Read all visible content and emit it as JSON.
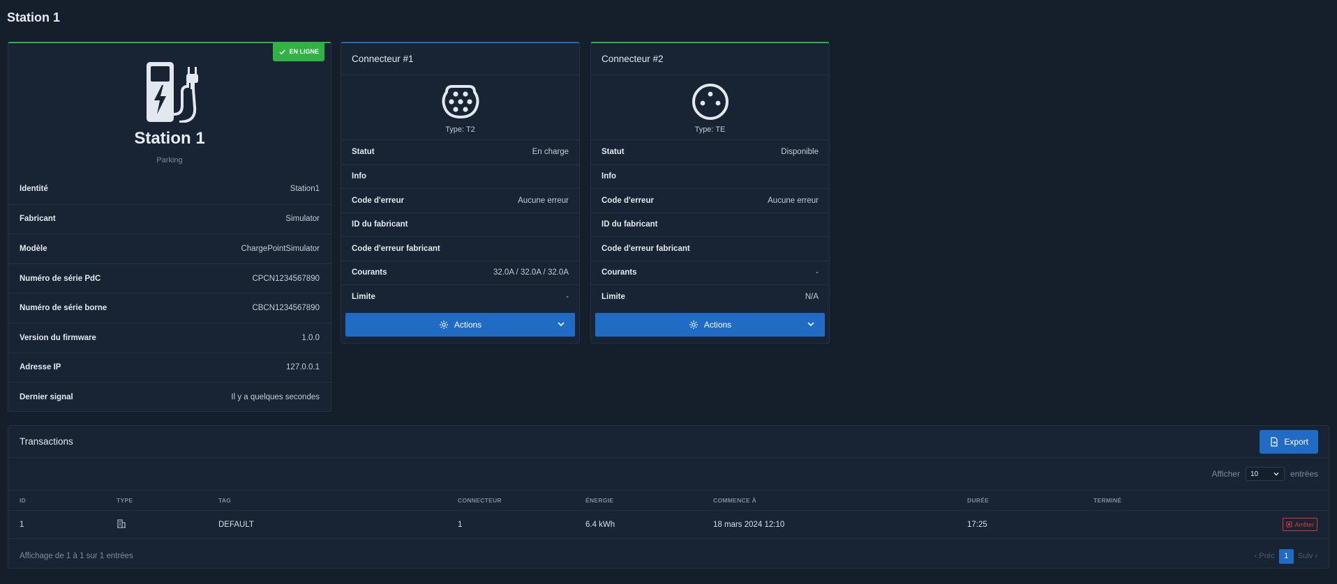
{
  "page": {
    "title": "Station 1"
  },
  "station": {
    "status_badge": "EN LIGNE",
    "name": "Station 1",
    "location": "Parking",
    "details": [
      {
        "key": "Identité",
        "value": "Station1"
      },
      {
        "key": "Fabricant",
        "value": "Simulator"
      },
      {
        "key": "Modèle",
        "value": "ChargePointSimulator"
      },
      {
        "key": "Numéro de série PdC",
        "value": "CPCN1234567890"
      },
      {
        "key": "Numéro de série borne",
        "value": "CBCN1234567890"
      },
      {
        "key": "Version du firmware",
        "value": "1.0.0"
      },
      {
        "key": "Adresse IP",
        "value": "127.0.0.1"
      },
      {
        "key": "Dernier signal",
        "value": "Il y a quelques secondes"
      }
    ]
  },
  "connectors": [
    {
      "title": "Connecteur #1",
      "type_label": "Type: T2",
      "icon": "type2-plug-icon",
      "rows": [
        {
          "key": "Statut",
          "value": "En charge"
        },
        {
          "key": "Info",
          "value": ""
        },
        {
          "key": "Code d'erreur",
          "value": "Aucune erreur"
        },
        {
          "key": "ID du fabricant",
          "value": ""
        },
        {
          "key": "Code d'erreur fabricant",
          "value": ""
        },
        {
          "key": "Courants",
          "value": "32.0A / 32.0A / 32.0A"
        },
        {
          "key": "Limite",
          "value": "-"
        }
      ],
      "actions_label": "Actions"
    },
    {
      "title": "Connecteur #2",
      "type_label": "Type: TE",
      "icon": "te-socket-icon",
      "rows": [
        {
          "key": "Statut",
          "value": "Disponible"
        },
        {
          "key": "Info",
          "value": ""
        },
        {
          "key": "Code d'erreur",
          "value": "Aucune erreur"
        },
        {
          "key": "ID du fabricant",
          "value": ""
        },
        {
          "key": "Code d'erreur fabricant",
          "value": ""
        },
        {
          "key": "Courants",
          "value": "-"
        },
        {
          "key": "Limite",
          "value": "N/A"
        }
      ],
      "actions_label": "Actions"
    }
  ],
  "transactions": {
    "title": "Transactions",
    "export_label": "Export",
    "show_label": "Afficher",
    "page_size": "10",
    "entries_label": "entrées",
    "columns": [
      "ID",
      "TYPE",
      "TAG",
      "CONNECTEUR",
      "ÉNERGIE",
      "COMMENCE À",
      "DURÉE",
      "TERMINÉ"
    ],
    "rows": [
      {
        "id": "1",
        "type_icon": "building-icon",
        "tag": "DEFAULT",
        "connector": "1",
        "energy": "6.4 kWh",
        "started": "18 mars 2024 12:10",
        "duration": "17:25",
        "ended": "",
        "stop_label": "Arrêter"
      }
    ],
    "footer": "Affichage de 1 à 1 sur 1 entrées",
    "prev_label": "Préc",
    "next_label": "Suiv",
    "current_page": "1"
  },
  "colors": {
    "accent": "#206bc4",
    "success": "#2fb344",
    "danger": "#d63939",
    "background": "#151f2c",
    "card": "#182433"
  }
}
